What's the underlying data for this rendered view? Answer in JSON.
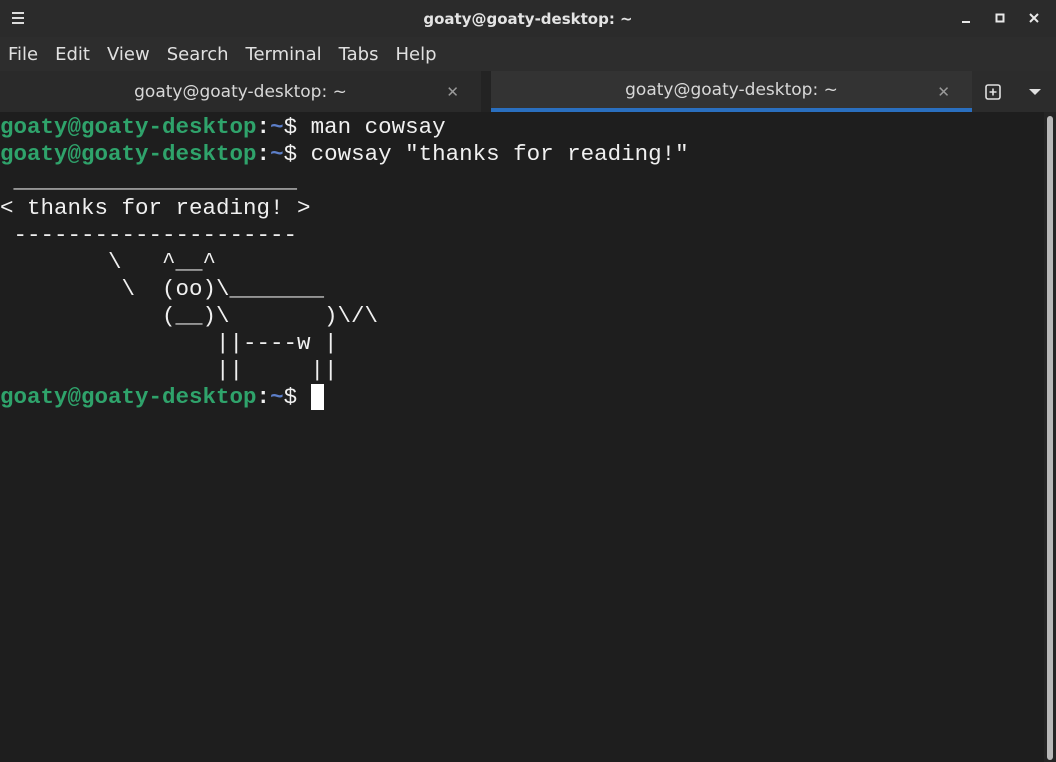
{
  "window": {
    "title": "goaty@goaty-desktop: ~"
  },
  "menubar": {
    "items": [
      "File",
      "Edit",
      "View",
      "Search",
      "Terminal",
      "Tabs",
      "Help"
    ]
  },
  "tabs": [
    {
      "label": "goaty@goaty-desktop: ~",
      "active": false
    },
    {
      "label": "goaty@goaty-desktop: ~",
      "active": true
    }
  ],
  "terminal": {
    "prompt": {
      "user_host": "goaty@goaty-desktop",
      "sep": ":",
      "dir": "~",
      "symbol": "$ "
    },
    "lines": [
      {
        "kind": "cmd",
        "text": "man cowsay"
      },
      {
        "kind": "cmd",
        "text": "cowsay \"thanks for reading!\""
      },
      {
        "kind": "out",
        "text": " _____________________"
      },
      {
        "kind": "out",
        "text": "< thanks for reading! >"
      },
      {
        "kind": "out",
        "text": " ---------------------"
      },
      {
        "kind": "out",
        "text": "        \\   ^__^"
      },
      {
        "kind": "out",
        "text": "         \\  (oo)\\_______"
      },
      {
        "kind": "out",
        "text": "            (__)\\       )\\/\\"
      },
      {
        "kind": "out",
        "text": "                ||----w |"
      },
      {
        "kind": "out",
        "text": "                ||     ||"
      },
      {
        "kind": "cmd",
        "text": ""
      }
    ]
  },
  "colors": {
    "prompt_user": "#2fa36b",
    "prompt_dir": "#5d7fc9",
    "active_tab_indicator": "#2a6fbf",
    "background": "#1e1e1e"
  }
}
